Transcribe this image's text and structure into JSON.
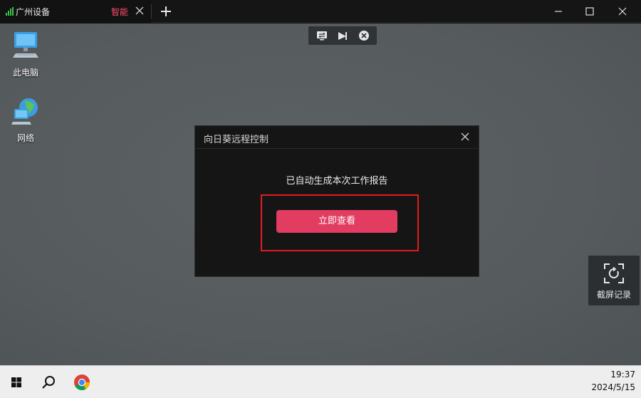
{
  "window": {
    "tab_title": "广州设备",
    "tab_tag": "智能",
    "tab_close": "close-tab",
    "new_tab": "+"
  },
  "desktop": {
    "icons": [
      {
        "label": "此电脑",
        "icon": "computer-icon"
      },
      {
        "label": "网络",
        "icon": "network-globe-icon"
      }
    ]
  },
  "dialog": {
    "title": "向日葵远程控制",
    "message": "已自动生成本次工作报告",
    "button": "立即查看"
  },
  "capture_panel": {
    "label": "截屏记录"
  },
  "taskbar": {
    "time": "19:37",
    "date": "2024/5/15"
  },
  "colors": {
    "accent": "#e23c60",
    "highlight": "#e31b1b",
    "tag": "#ff4d6d"
  }
}
